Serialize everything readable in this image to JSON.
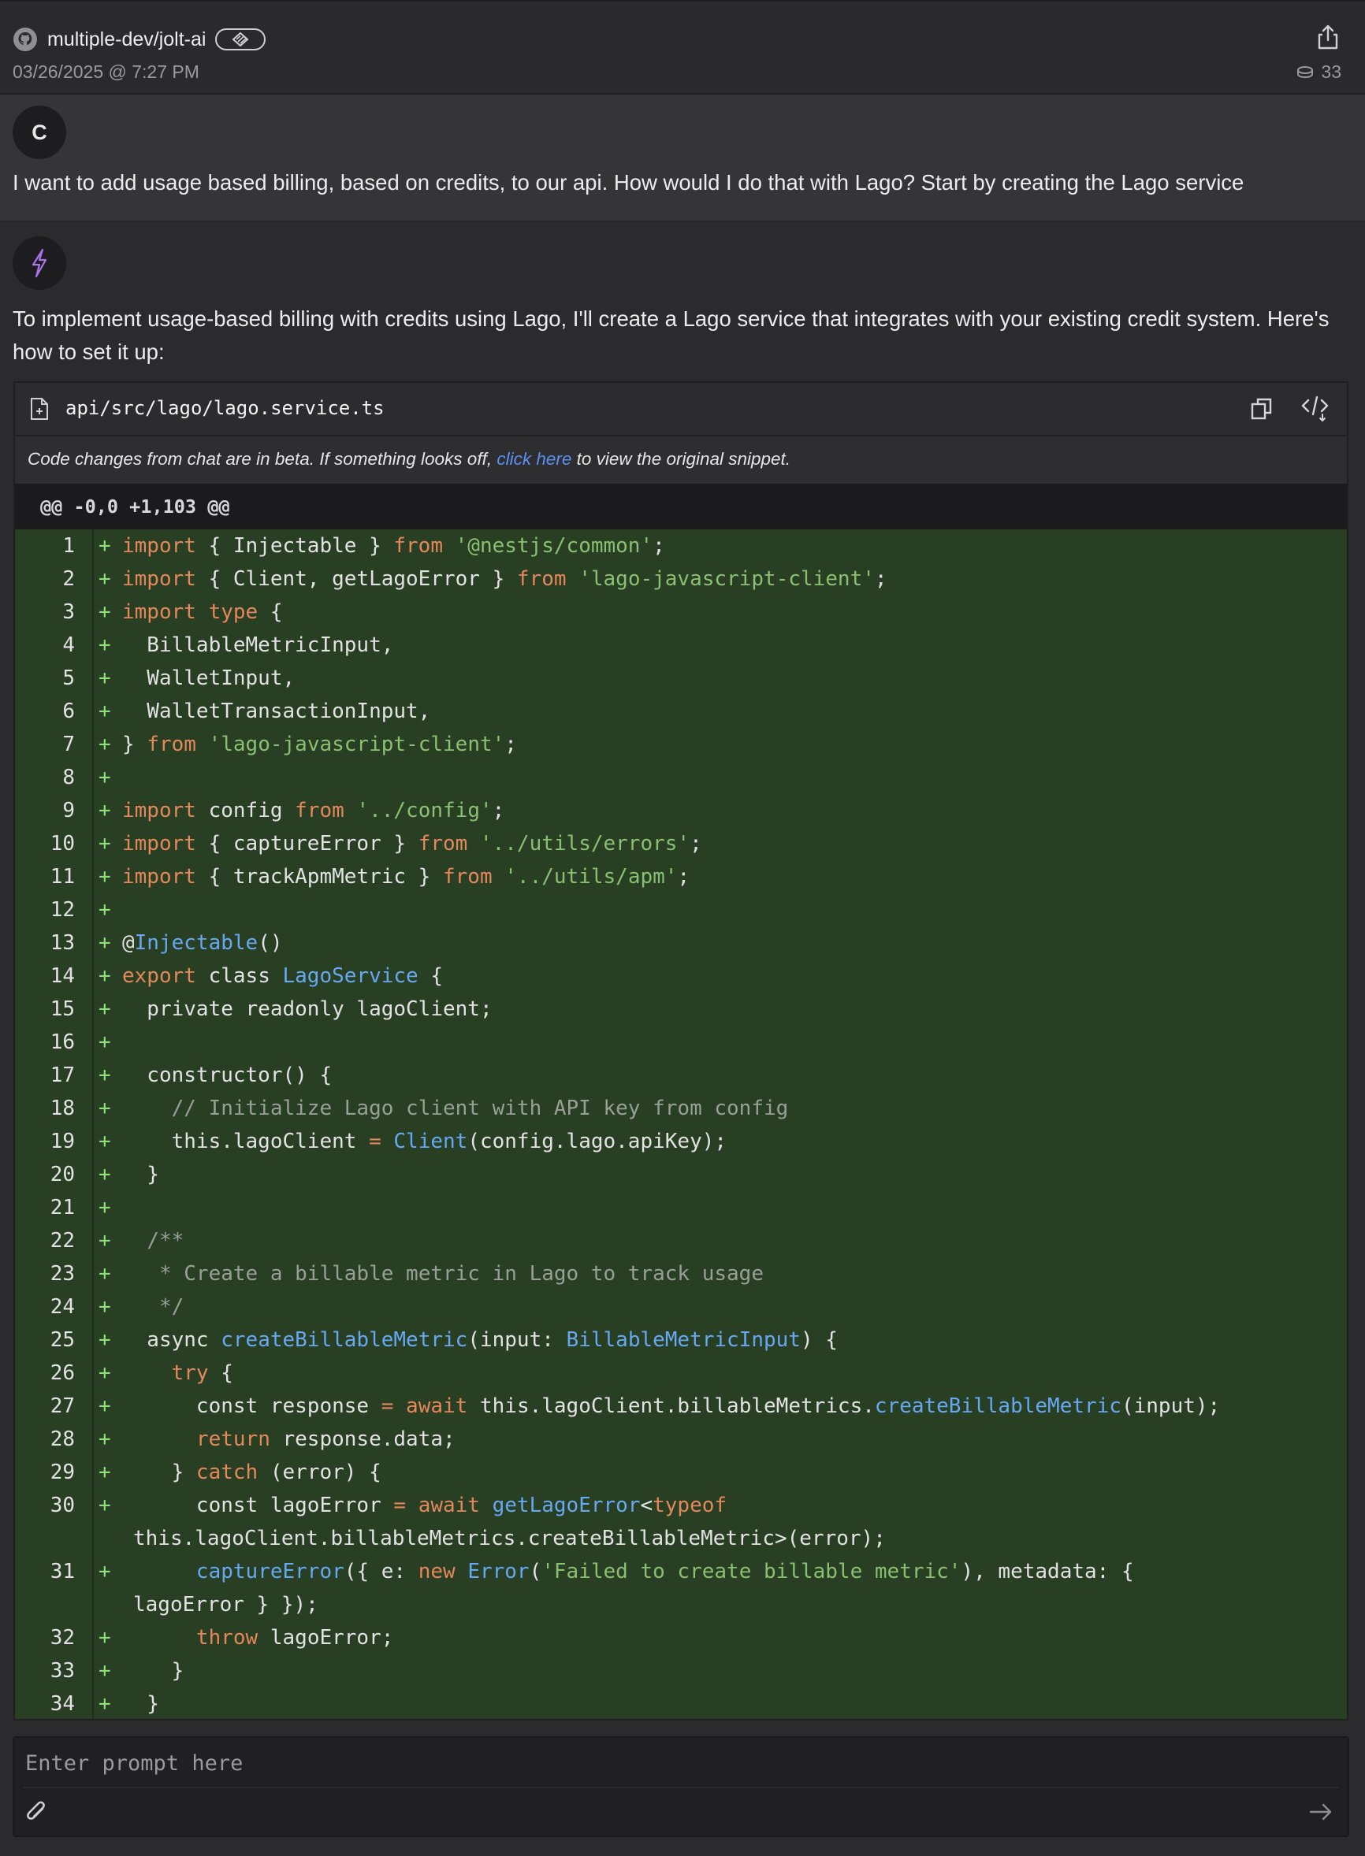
{
  "header": {
    "repo": "multiple-dev/jolt-ai",
    "timestamp": "03/26/2025 @ 7:27 PM",
    "count": "33"
  },
  "user_message": {
    "avatar_letter": "C",
    "text": "I want to add usage based billing, based on credits, to our api. How would I do that with Lago? Start by creating the Lago service"
  },
  "assistant_message": {
    "text": "To implement usage-based billing with credits using Lago, I'll create a Lago service that integrates with your existing credit system. Here's how to set it up:"
  },
  "code_block": {
    "file_name": "api/src/lago/lago.service.ts",
    "beta_prefix": "Code changes from chat are in beta. If something looks off,",
    "beta_link": "click here",
    "beta_suffix": "to view the original snippet.",
    "hunk_header": "@@ -0,0 +1,103 @@",
    "line_numbers": [
      "1",
      "2",
      "3",
      "4",
      "5",
      "6",
      "7",
      "8",
      "9",
      "10",
      "11",
      "12",
      "13",
      "14",
      "15",
      "16",
      "17",
      "18",
      "19",
      "20",
      "21",
      "22",
      "23",
      "24",
      "25",
      "26",
      "27",
      "28",
      "29",
      "30",
      "31",
      "32",
      "33",
      "34"
    ],
    "plus_sign": "+"
  },
  "prompt": {
    "placeholder": "Enter prompt here"
  }
}
